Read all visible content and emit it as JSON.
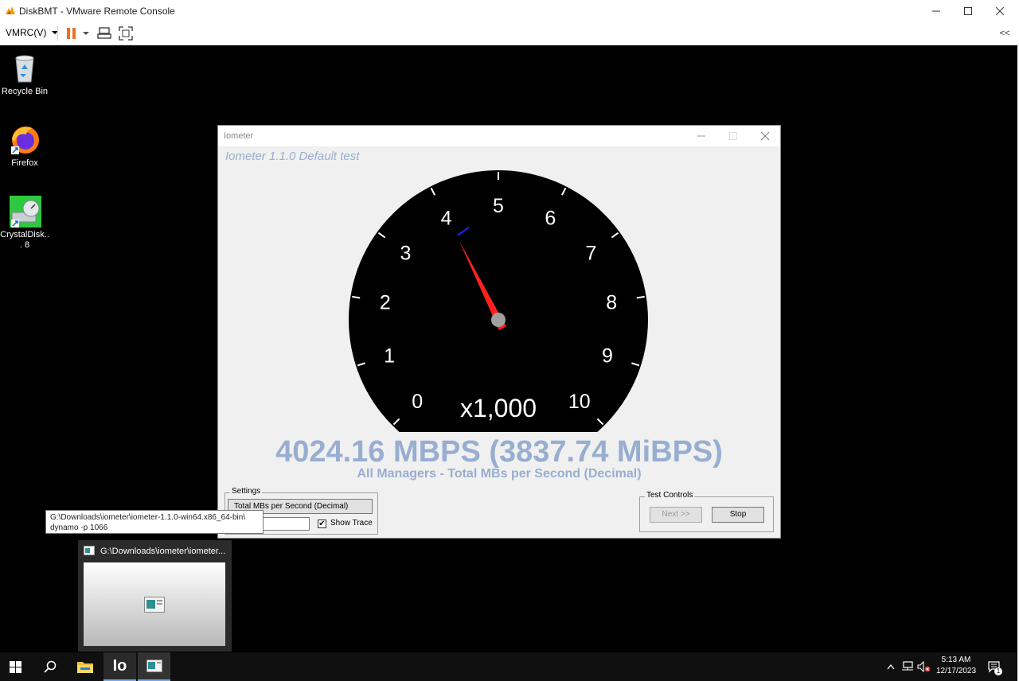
{
  "vm_window": {
    "title": "DiskBMT - VMware Remote Console",
    "vmrc_menu_label": "VMRC(V)",
    "right_toolbar_glyph": "<<"
  },
  "desktop_icons": [
    {
      "label": "Recycle Bin",
      "icon": "recycle-bin-icon"
    },
    {
      "label": "Firefox",
      "icon": "firefox-icon"
    },
    {
      "label": "CrystalDisk... 8",
      "icon": "crystaldiskmark-icon"
    }
  ],
  "iometer": {
    "window_title": "Iometer",
    "heading": "Iometer 1.1.0 Default test",
    "gauge": {
      "ticks": [
        "0",
        "1",
        "2",
        "3",
        "4",
        "5",
        "6",
        "7",
        "8",
        "9",
        "10"
      ],
      "multiplier": "x1,000",
      "min": 0,
      "max": 10,
      "needle_value": 4.02416,
      "max_marker_value": 4.2,
      "colors": {
        "face": "#000000",
        "ticks": "#ffffff",
        "needle": "#ff2020",
        "max_marker": "#2020ff",
        "hub": "#a0a0a0"
      }
    },
    "value_text": "4024.16 MBPS (3837.74 MiBPS)",
    "value_caption": "All Managers - Total MBs per Second (Decimal)",
    "settings": {
      "group_label": "Settings",
      "metric_button": "Total MBs per Second (Decimal)",
      "show_trace_label": "Show Trace",
      "show_trace_checked": true,
      "check_glyph": "✔"
    },
    "test_controls": {
      "group_label": "Test Controls",
      "next_button": "Next >>",
      "stop_button": "Stop"
    },
    "accent_color": "#98aed0"
  },
  "tooltip": {
    "line1": "G:\\Downloads\\iometer\\iometer-1.1.0-win64.x86_64-bin\\",
    "line2": "dynamo -p 1066"
  },
  "thumbnail": {
    "title": "G:\\Downloads\\iometer\\iometer..."
  },
  "taskbar": {
    "iometer_label": "Io",
    "time": "5:13 AM",
    "date": "12/17/2023",
    "notification_count": "1"
  }
}
